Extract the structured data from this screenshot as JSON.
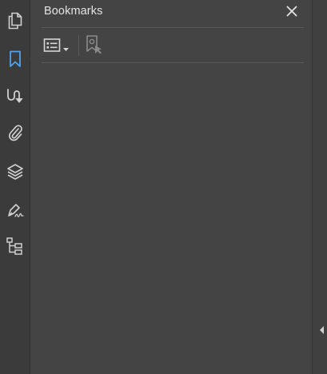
{
  "rail": {
    "items": [
      {
        "name": "page-thumbnails",
        "icon": "pages-icon",
        "active": false
      },
      {
        "name": "bookmarks",
        "icon": "bookmark-icon",
        "active": true
      },
      {
        "name": "content",
        "icon": "content-icon",
        "active": false
      },
      {
        "name": "attachments",
        "icon": "paperclip-icon",
        "active": false
      },
      {
        "name": "layers",
        "icon": "layers-icon",
        "active": false
      },
      {
        "name": "signatures",
        "icon": "signature-icon",
        "active": false
      },
      {
        "name": "tags",
        "icon": "tags-tree-icon",
        "active": false
      }
    ]
  },
  "panel": {
    "title": "Bookmarks",
    "close_icon": "close-icon",
    "toolbar": {
      "options_icon": "options-menu-icon",
      "new_bookmark_icon": "new-bookmark-icon",
      "new_bookmark_enabled": false
    }
  },
  "colors": {
    "active_icon": "#4da3f0",
    "icon": "#cfcfcf",
    "disabled_icon": "#8a8a8a"
  },
  "collapse_icon": "chevron-left-icon"
}
